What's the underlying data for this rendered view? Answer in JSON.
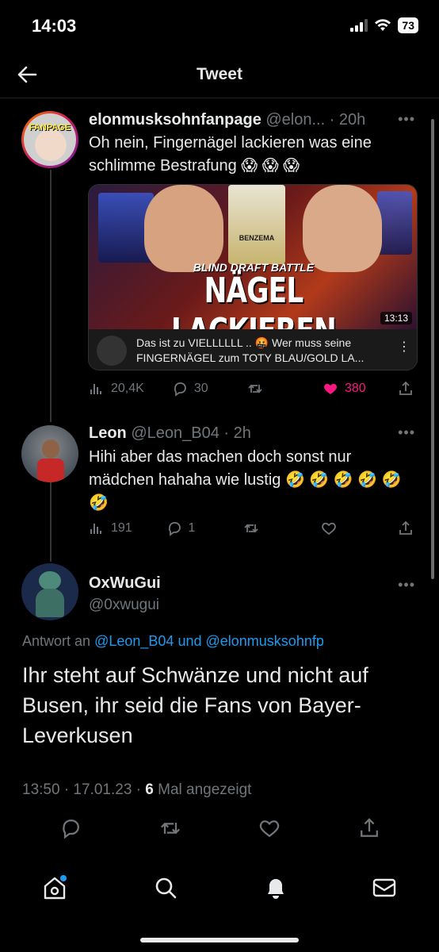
{
  "status_bar": {
    "time": "14:03",
    "battery": "73"
  },
  "header": {
    "title": "Tweet"
  },
  "tweet1": {
    "name": "elonmusksohnfanpage",
    "handle_time": "@elon... · 20h",
    "avatar_label": "FANPAGE",
    "text": "Oh nein, Fingernägel lackieren was eine schlimme Bestrafung 😱 😱 😱",
    "media": {
      "overlay_title": "NÄGEL LACKIEREN",
      "overlay_sub": "BLIND DRAFT BATTLE",
      "player_name": "BENZEMA",
      "duration": "13:13",
      "video_title_line1": "Das ist zu VIELLLLLL .. 🤬 Wer muss seine",
      "video_title_line2": "FINGERNÄGEL zum TOTY BLAU/GOLD LA..."
    },
    "stats": {
      "views": "20,4K",
      "replies": "30",
      "retweets": "",
      "likes": "380"
    }
  },
  "tweet2": {
    "name": "Leon",
    "handle_time": "@Leon_B04 · 2h",
    "text": "Hihi aber das machen doch sonst nur mädchen hahaha wie lustig 🤣 🤣 🤣 🤣 🤣 🤣",
    "stats": {
      "views": "191",
      "replies": "1",
      "retweets": "",
      "likes": ""
    }
  },
  "main_tweet": {
    "name": "OxWuGui",
    "handle": "@0xwugui",
    "reply_prefix": "Antwort an",
    "reply_link1": "@Leon_B04",
    "reply_and": "und",
    "reply_link2": "@elonmusksohnfp",
    "text": "Ihr steht auf Schwänze und nicht auf Busen, ihr seid die Fans von Bayer-Leverkusen",
    "timestamp": "13:50 · 17.01.23 ·",
    "view_count": "6",
    "view_label": "Mal angezeigt"
  },
  "tabbar": {
    "items": [
      "home-icon",
      "search-icon",
      "bell-icon",
      "mail-icon"
    ]
  },
  "colors": {
    "accent": "#1d9bf0",
    "like": "#f91880",
    "muted": "#71767b"
  }
}
